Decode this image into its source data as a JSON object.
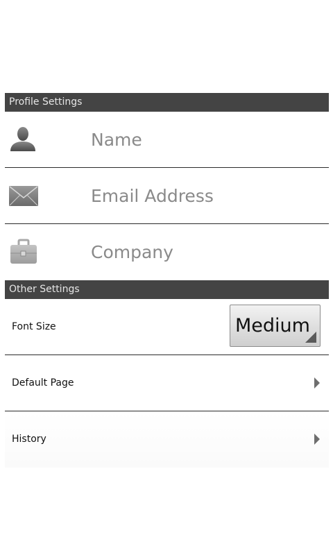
{
  "profile_settings": {
    "header": "Profile Settings",
    "fields": [
      {
        "icon": "person-icon",
        "placeholder": "Name"
      },
      {
        "icon": "envelope-icon",
        "placeholder": "Email Address"
      },
      {
        "icon": "briefcase-icon",
        "placeholder": "Company"
      }
    ]
  },
  "other_settings": {
    "header": "Other Settings",
    "font_size": {
      "label": "Font Size",
      "value": "Medium"
    },
    "default_page": {
      "label": "Default Page",
      "icon": "chevron-right-icon"
    },
    "history": {
      "label": "History",
      "icon": "chevron-right-icon"
    }
  },
  "colors": {
    "header_bg": "#444444",
    "header_text": "#e6e6e6",
    "divider": "#2a2a2a",
    "placeholder_text": "#8a8a8a"
  }
}
